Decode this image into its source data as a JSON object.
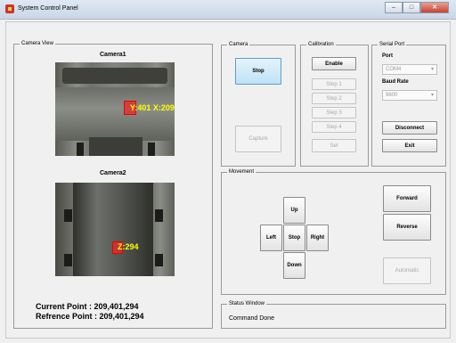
{
  "window": {
    "title": "System Control Panel"
  },
  "camera_view": {
    "title": "Camera View",
    "camera1_label": "Camera1",
    "camera2_label": "Camera2",
    "camera1_overlay": "Y:401  X:209",
    "camera2_overlay": "Z:294",
    "current_point": "Current   Point : 209,401,294",
    "reference_point": "Refrence Point : 209,401,294"
  },
  "camera_panel": {
    "title": "Camera",
    "stop_label": "Stop",
    "capture_label": "Capture"
  },
  "calibration": {
    "title": "Calibration",
    "enable_label": "Enable",
    "steps": [
      "Step 1",
      "Step 2",
      "Step 3",
      "Step 4"
    ],
    "set_label": "Set"
  },
  "serial_port": {
    "title": "Serial Port",
    "port_label": "Port",
    "port_value": "COM4",
    "baud_label": "Baud Rate",
    "baud_value": "9600",
    "disconnect_label": "Disconnect",
    "exit_label": "Exit"
  },
  "movement": {
    "title": "Movement",
    "up": "Up",
    "left": "Left",
    "stop": "Stop",
    "right": "Right",
    "down": "Down",
    "forward": "Forward",
    "reverse": "Reverse",
    "automatic": "Automatic"
  },
  "status": {
    "title": "Status Window",
    "text": "Command Done"
  }
}
